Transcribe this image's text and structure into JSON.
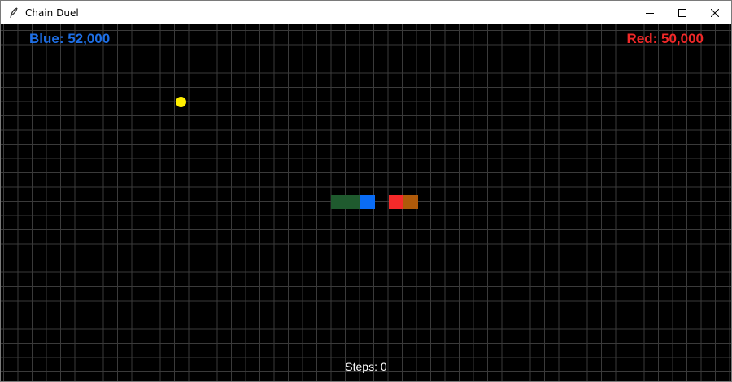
{
  "window": {
    "title": "Chain Duel",
    "icons": {
      "app": "feather-icon",
      "minimize": "minimize-icon",
      "maximize": "maximize-icon",
      "close": "close-icon"
    }
  },
  "scores": {
    "blue_label": "Blue: 52,000",
    "red_label": "Red: 50,000"
  },
  "colors": {
    "background": "#000000",
    "grid": "#3a3a3a",
    "blue_text": "#1e6fe6",
    "red_text": "#f02828",
    "blue_head": "#0a6cf5",
    "blue_body": "#1f5a2e",
    "red_head": "#f52a2a",
    "red_body": "#b05a0a",
    "food": "#ffee00"
  },
  "status": {
    "steps_label": "Steps:",
    "steps_value": "0"
  }
}
